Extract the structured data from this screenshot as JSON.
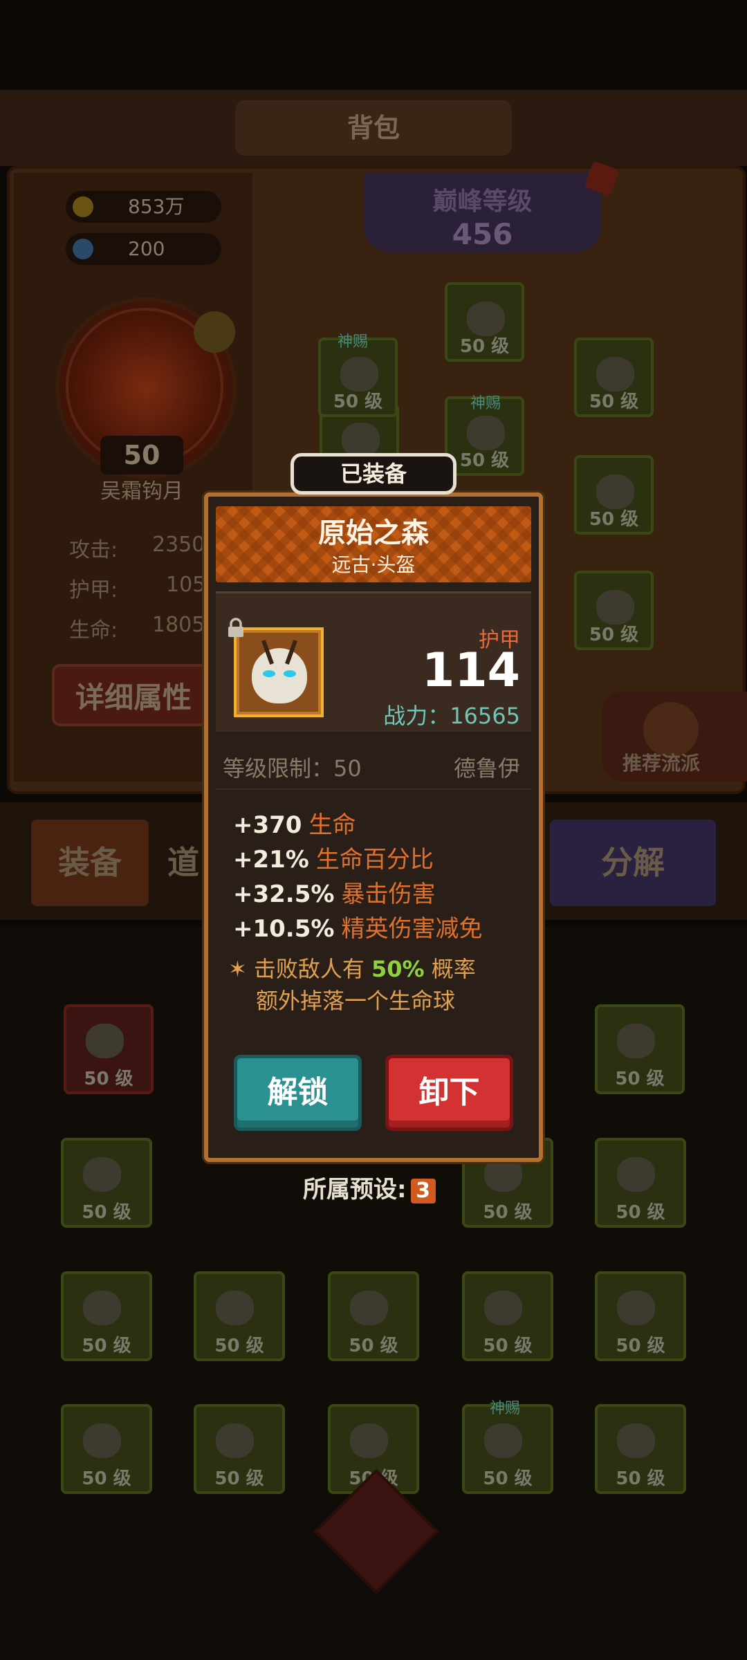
{
  "header": {
    "title": "背包"
  },
  "currency": {
    "gold": "853万",
    "gems": "200"
  },
  "character": {
    "level": "50",
    "name": "吴霜钩月"
  },
  "stats": [
    {
      "label": "攻击:",
      "value": "2350"
    },
    {
      "label": "护甲:",
      "value": "105"
    },
    {
      "label": "生命:",
      "value": "1805"
    }
  ],
  "detail_button": "详细属性",
  "peak": {
    "title": "巅峰等级",
    "level": "456"
  },
  "slot_level_label": "50 级",
  "god_tag": "神赐",
  "recommend_label": "推荐流派",
  "tabs": {
    "equip": "装备",
    "items": "道",
    "decompose": "分解"
  },
  "popup": {
    "equipped_tag": "已装备",
    "item_name": "原始之森",
    "item_sub": "远古·头盔",
    "stat_type": "护甲",
    "stat_value": "114",
    "power": "战力：16565",
    "level_req": "等级限制：50",
    "class": "德鲁伊",
    "attributes": [
      {
        "value": "+370",
        "name": "生命"
      },
      {
        "value": "+21%",
        "name": "生命百分比"
      },
      {
        "value": "+32.5%",
        "name": "暴击伤害"
      },
      {
        "value": "+10.5%",
        "name": "精英伤害减免"
      }
    ],
    "special": {
      "prefix": "击败敌人有",
      "percent": "50%",
      "mid": "概率",
      "line2": "额外掉落一个生命球"
    },
    "buttons": {
      "unlock": "解锁",
      "remove": "卸下"
    },
    "preset_label": "所属预设:",
    "preset_value": "3"
  },
  "colors": {
    "armor": "#e86a3a",
    "power": "#6fc6b8",
    "unlock": "#2a9090",
    "remove": "#d43232",
    "frame": "#b3702e"
  }
}
